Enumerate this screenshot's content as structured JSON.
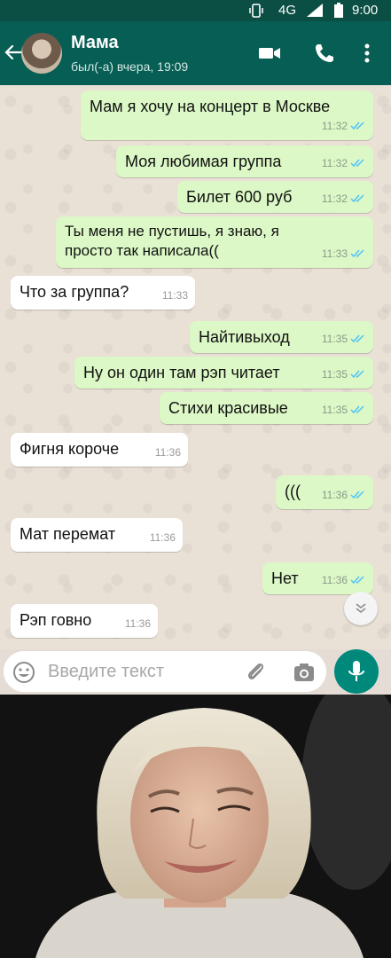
{
  "status_bar": {
    "network": "4G",
    "time": "9:00"
  },
  "header": {
    "contact_name": "Мама",
    "last_seen": "был(-а) вчера, 19:09"
  },
  "messages": [
    {
      "dir": "out",
      "text": "Мам я хочу на концерт в Москве",
      "time": "11:32"
    },
    {
      "dir": "out",
      "text": "Моя любимая группа",
      "time": "11:32"
    },
    {
      "dir": "out",
      "text": "Билет 600 руб",
      "time": "11:32"
    },
    {
      "dir": "out",
      "text": "Ты меня не пустишь, я знаю, я\nпросто так написала((",
      "time": "11:33"
    },
    {
      "dir": "in",
      "text": "Что за группа?",
      "time": "11:33"
    },
    {
      "dir": "out",
      "text": "Найтивыход",
      "time": "11:35"
    },
    {
      "dir": "out",
      "text": "Ну он один там рэп читает",
      "time": "11:35"
    },
    {
      "dir": "out",
      "text": "Стихи красивые",
      "time": "11:35"
    },
    {
      "dir": "in",
      "text": "Фигня короче",
      "time": "11:36"
    },
    {
      "dir": "out",
      "text": "(((",
      "time": "11:36"
    },
    {
      "dir": "in",
      "text": "Мат перемат",
      "time": "11:36"
    },
    {
      "dir": "out",
      "text": "Нет",
      "time": "11:36"
    },
    {
      "dir": "in",
      "text": "Рэп говно",
      "time": "11:36"
    }
  ],
  "input": {
    "placeholder": "Введите текст"
  },
  "colors": {
    "header": "#075e54",
    "status_bar": "#0b4f44",
    "outgoing": "#dcf8c6",
    "incoming": "#ffffff",
    "ticks": "#4fc3f7",
    "mic": "#00897b"
  },
  "icons": [
    "back-arrow-icon",
    "video-icon",
    "call-icon",
    "menu-icon",
    "emoji-icon",
    "attach-icon",
    "camera-icon",
    "mic-icon",
    "chevron-down-icon",
    "read-ticks-icon"
  ]
}
